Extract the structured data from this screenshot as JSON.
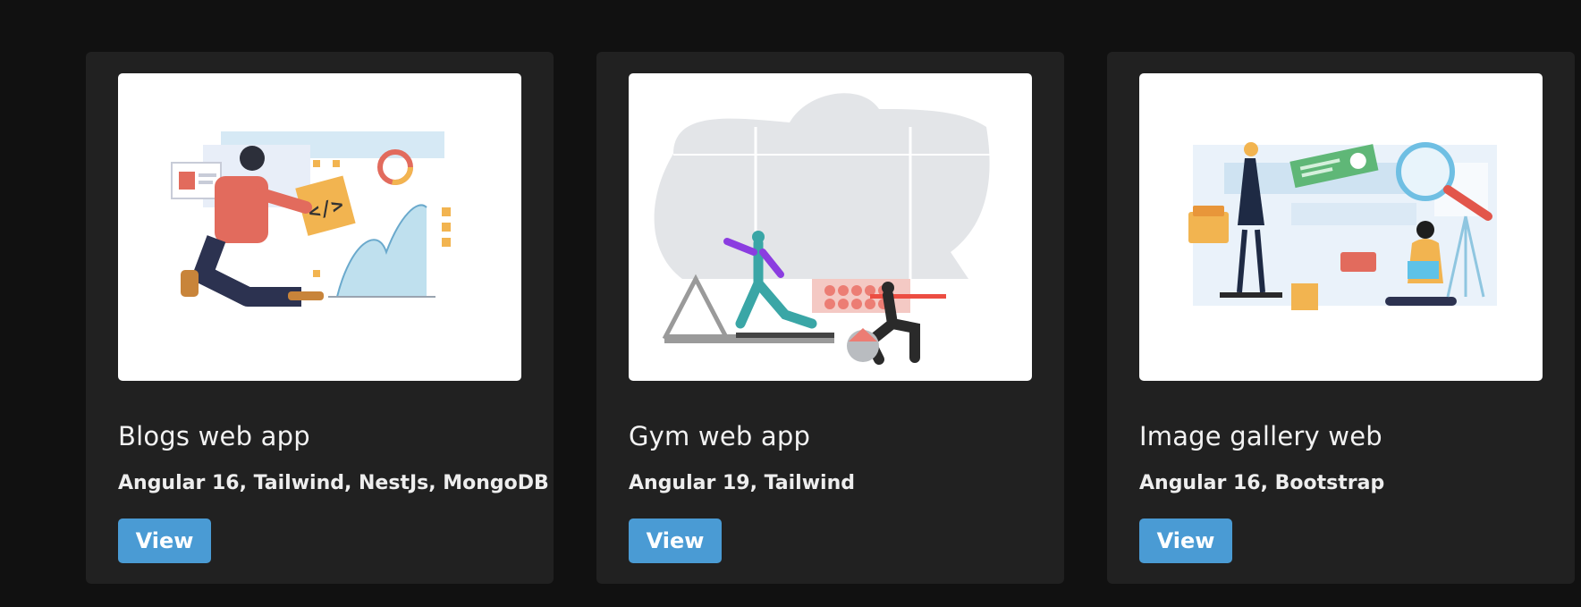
{
  "cards": [
    {
      "title": "Blogs web app",
      "tech": "Angular 16, Tailwind, NestJs, MongoDB",
      "button_label": "View",
      "image_icon": "developer-coding-illustration"
    },
    {
      "title": "Gym web app",
      "tech": "Angular 19, Tailwind",
      "button_label": "View",
      "image_icon": "gym-workout-illustration"
    },
    {
      "title": "Image gallery web",
      "tech": "Angular 16, Bootstrap",
      "button_label": "View",
      "image_icon": "image-gallery-illustration"
    }
  ],
  "colors": {
    "page_bg": "#111111",
    "card_bg": "#212121",
    "button_bg": "#4a9bd4",
    "text": "#f2f2f2"
  }
}
